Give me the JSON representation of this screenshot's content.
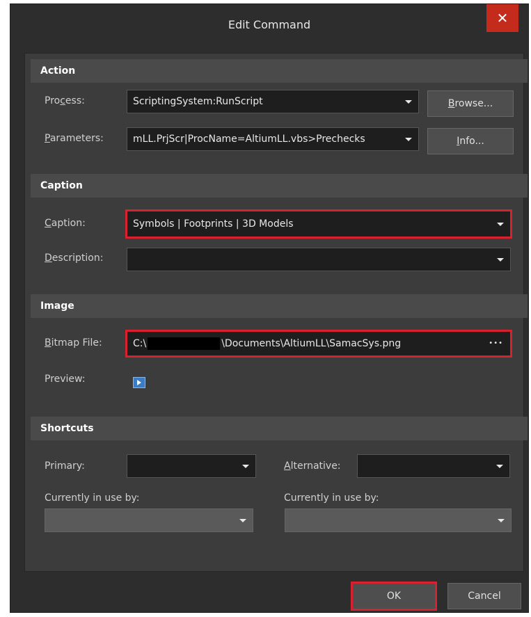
{
  "window": {
    "title": "Edit Command",
    "close_label": "✕"
  },
  "sections": {
    "action": "Action",
    "caption": "Caption",
    "image": "Image",
    "shortcuts": "Shortcuts"
  },
  "action": {
    "process_label_pre": "Pro",
    "process_label_u": "c",
    "process_label_post": "ess:",
    "process_value": "ScriptingSystem:RunScript",
    "browse_u": "B",
    "browse_post": "rowse...",
    "parameters_label_u": "P",
    "parameters_label_post": "arameters:",
    "parameters_value": "mLL.PrjScr|ProcName=AltiumLL.vbs>Prechecks",
    "info_u": "I",
    "info_post": "nfo..."
  },
  "caption": {
    "caption_label_u": "C",
    "caption_label_post": "aption:",
    "caption_value": "Symbols | Footprints | 3D Models",
    "description_label_u": "D",
    "description_label_post": "escription:",
    "description_value": ""
  },
  "image": {
    "bitmap_label_u": "B",
    "bitmap_label_post": "itmap File:",
    "bitmap_prefix": "C:\\",
    "bitmap_suffix": "\\Documents\\AltiumLL\\SamacSys.png",
    "bitmap_ellipsis": "•••",
    "preview_label": "Preview:"
  },
  "shortcuts": {
    "primary_label": "Primary:",
    "primary_value": "",
    "alternative_label_u": "A",
    "alternative_label_post": "lternative:",
    "alternative_value": "",
    "in_use_left_label": "Currently in use by:",
    "in_use_left_value": "",
    "in_use_right_label": "Currently in use by:",
    "in_use_right_value": ""
  },
  "footer": {
    "ok_label": "OK",
    "cancel_label": "Cancel"
  },
  "colors": {
    "highlight": "#d8202e",
    "close_button": "#c42b1c"
  }
}
